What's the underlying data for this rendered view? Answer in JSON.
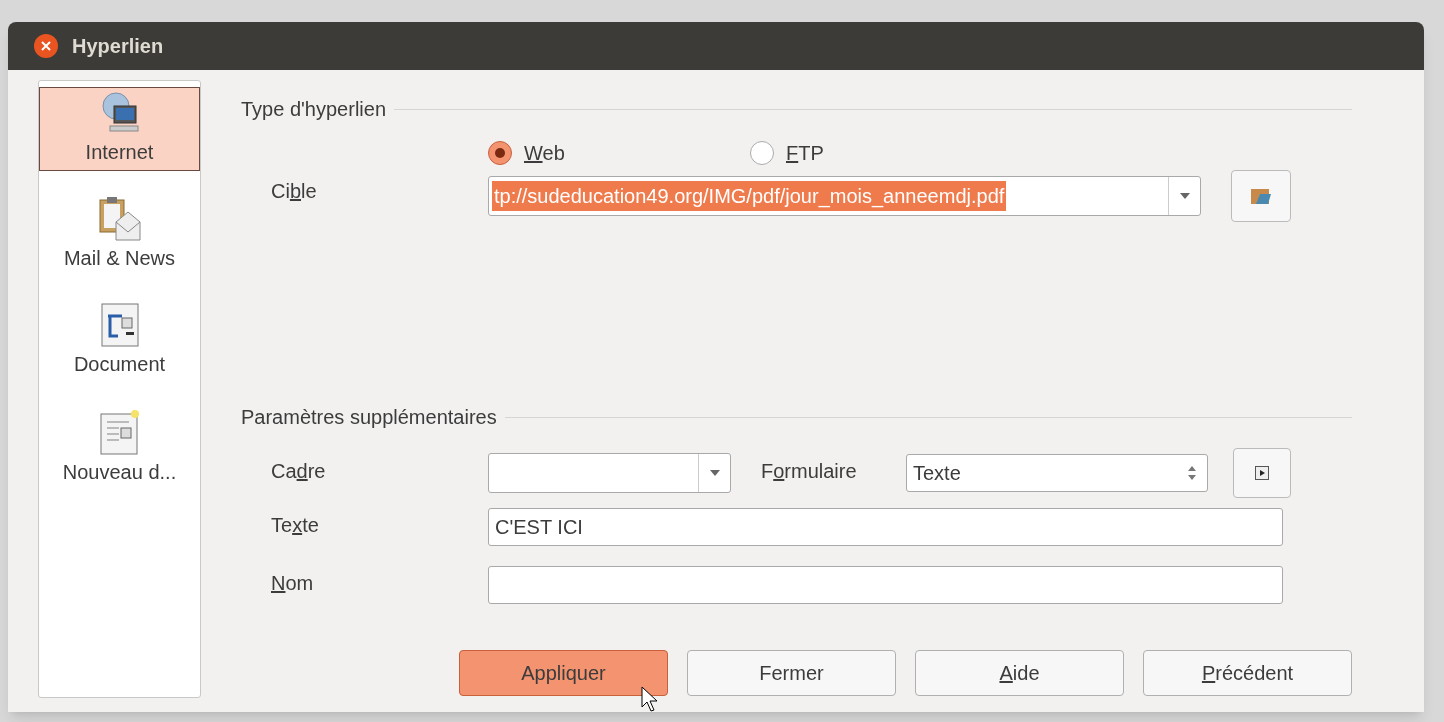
{
  "window": {
    "title": "Hyperlien"
  },
  "sidebar": {
    "items": [
      {
        "label": "Internet",
        "kind": "internet",
        "selected": true
      },
      {
        "label": "Mail & News",
        "kind": "mail",
        "selected": false
      },
      {
        "label": "Document",
        "kind": "document",
        "selected": false
      },
      {
        "label": "Nouveau d...",
        "kind": "new-document",
        "selected": false
      }
    ]
  },
  "hyperlink_type": {
    "heading": "Type d'hyperlien",
    "radios": [
      {
        "label": {
          "key": "W",
          "after": "eb"
        },
        "selected": true
      },
      {
        "label": {
          "key": "F",
          "after": "TP"
        },
        "selected": false
      }
    ],
    "target": {
      "label": {
        "before": "Ci",
        "key": "b",
        "after": "le"
      },
      "value": "tp://sudeducation49.org/IMG/pdf/jour_mois_anneemdj.pdf"
    }
  },
  "extra_settings": {
    "heading": "Paramètres supplémentaires",
    "frame": {
      "label": {
        "before": "Ca",
        "key": "d",
        "after": "re"
      }
    },
    "form": {
      "label": {
        "before": "F",
        "key": "o",
        "after": "rmulaire"
      },
      "value": "Texte"
    },
    "text": {
      "label": {
        "before": "Te",
        "key": "x",
        "after": "te"
      },
      "value": "C'EST ICI"
    },
    "name": {
      "label": {
        "key": "N",
        "after": "om"
      }
    }
  },
  "buttons": [
    {
      "label": {
        "before": "Appliquer"
      },
      "kind": "default"
    },
    {
      "label": {
        "before": "Fermer"
      },
      "kind": "normal"
    },
    {
      "label": {
        "key": "A",
        "after": "ide"
      },
      "kind": "normal"
    },
    {
      "label": {
        "key": "P",
        "after": "récédent"
      },
      "kind": "normal"
    }
  ]
}
